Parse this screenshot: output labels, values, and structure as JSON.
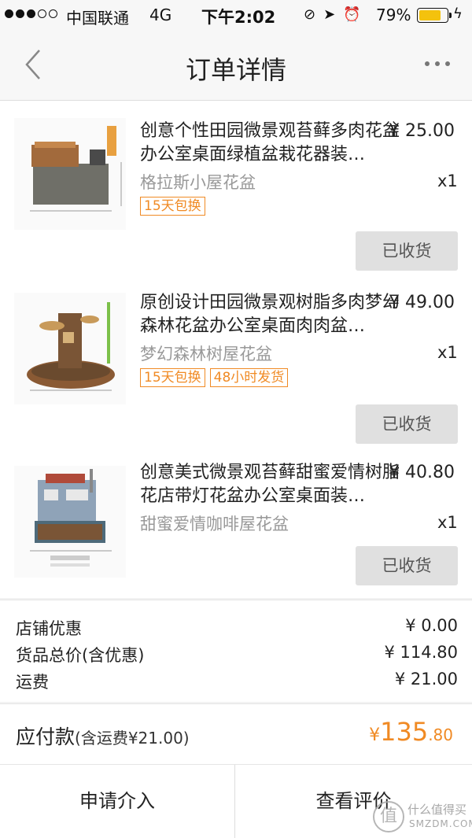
{
  "status_bar": {
    "carrier": "中国联通",
    "network": "4G",
    "time": "下午2:02",
    "battery": "79%",
    "battery_level": 0.79,
    "icons": [
      "orientation-lock-icon",
      "location-icon",
      "alarm-icon"
    ]
  },
  "nav": {
    "title": "订单详情",
    "back_icon": "chevron-left-icon",
    "more_icon": "more-dots-icon"
  },
  "items": [
    {
      "title": "创意个性田园微景观苔藓多肉花盆办公室桌面绿植盆栽花器装…",
      "price": "¥ 25.00",
      "spec": "格拉斯小屋花盆",
      "qty": "x1",
      "tags": [
        "15天包换"
      ],
      "status": "已收货"
    },
    {
      "title": "原创设计田园微景观树脂多肉梦幻森林花盆办公室桌面肉肉盆…",
      "price": "¥ 49.00",
      "spec": "梦幻森林树屋花盆",
      "qty": "x1",
      "tags": [
        "15天包换",
        "48小时发货"
      ],
      "status": "已收货"
    },
    {
      "title": "创意美式微景观苔藓甜蜜爱情树脂花店带灯花盆办公室桌面装…",
      "price": "¥ 40.80",
      "spec": "甜蜜爱情咖啡屋花盆",
      "qty": "x1",
      "tags": [],
      "status": "已收货"
    }
  ],
  "summary": {
    "shop_discount_label": "店铺优惠",
    "shop_discount_value": "¥ 0.00",
    "goods_total_label": "货品总价(含优惠)",
    "goods_total_value": "¥ 114.80",
    "shipping_label": "运费",
    "shipping_value": "¥ 21.00"
  },
  "total": {
    "label": "应付款",
    "note": "(含运费¥21.00)",
    "symbol": "¥",
    "integer": "135",
    "decimal": ".80",
    "accent_color": "#f08a24"
  },
  "actions": {
    "left": "申请介入",
    "right": "查看评价"
  },
  "watermark": {
    "logo": "值",
    "cn": "什么值得买",
    "en": "SMZDM.COM"
  }
}
